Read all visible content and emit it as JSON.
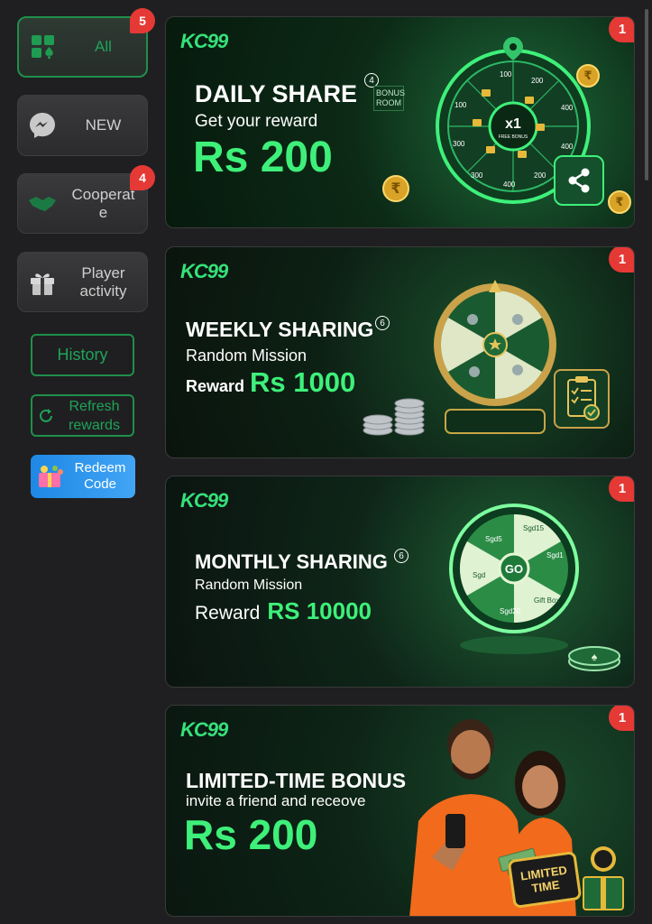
{
  "sidebar": {
    "items": [
      {
        "label": "All",
        "badge": "5",
        "icon": "grid-spade-icon"
      },
      {
        "label": "NEW",
        "badge": "",
        "icon": "messenger-icon"
      },
      {
        "label": "Cooperate",
        "badge": "4",
        "icon": "handshake-icon"
      },
      {
        "label": "Player activity",
        "badge": "",
        "icon": "gift-icon"
      }
    ],
    "history_label": "History",
    "refresh_label": "Refresh rewards",
    "redeem_label": "Redeem Code"
  },
  "banners": [
    {
      "logo": "KC99",
      "title": "DAILY SHARE",
      "title_badge": "4",
      "subtitle": "Get your reward",
      "amount": "Rs 200",
      "badge": "1",
      "wheel_center": "x1",
      "wheel_center_sub": "FREE BONUS",
      "wheel_values": [
        "100",
        "200",
        "400",
        "400",
        "200",
        "400",
        "300",
        "300",
        "100"
      ],
      "room_sign": "BONUS ROOM"
    },
    {
      "logo": "KC99",
      "title": "WEEKLY SHARING",
      "title_badge": "6",
      "subtitle": "Random Mission",
      "amount_prefix": "Reward",
      "amount": "Rs 1000",
      "badge": "1"
    },
    {
      "logo": "KC99",
      "title": "MONTHLY SHARING",
      "title_badge": "6",
      "subtitle": "Random Mission",
      "amount_prefix": "Reward",
      "amount": "RS 10000",
      "badge": "1",
      "wheel_center": "GO",
      "wheel_values": [
        "Sgd15",
        "Sgd1",
        "Gift Box",
        "Sgd20",
        "Sgd",
        "Sgd5"
      ]
    },
    {
      "logo": "KC99",
      "title": "LIMITED-TIME BONUS",
      "subtitle": "invite a friend and receove",
      "amount": "Rs 200",
      "badge": "1",
      "sign": "LIMITED TIME"
    }
  ],
  "colors": {
    "accent": "#3ef07a",
    "badge": "#e53935",
    "border_green": "#1f8f4a"
  }
}
